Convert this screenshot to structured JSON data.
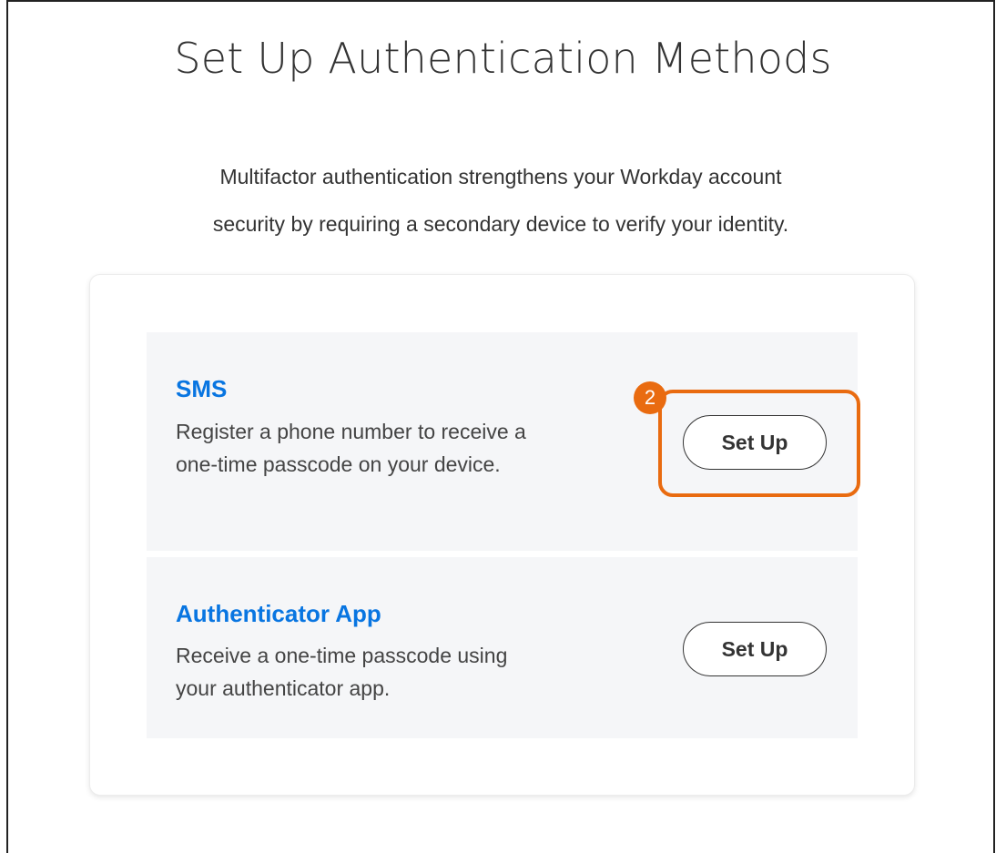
{
  "page": {
    "title": "Set Up Authentication Methods",
    "intro_line1": "Multifactor authentication strengthens your Workday account",
    "intro_line2": "security by requiring a secondary device to verify your identity."
  },
  "methods": [
    {
      "title": "SMS",
      "description": "Register a phone number to receive a one-time passcode on your device.",
      "button_label": "Set Up"
    },
    {
      "title": "Authenticator App",
      "description": "Receive a one-time passcode using your authenticator app.",
      "button_label": "Set Up"
    }
  ],
  "annotation": {
    "step_number": "2",
    "highlight_color": "#e96b10"
  },
  "colors": {
    "accent": "#0875e1",
    "method_background": "#f5f6f8"
  }
}
